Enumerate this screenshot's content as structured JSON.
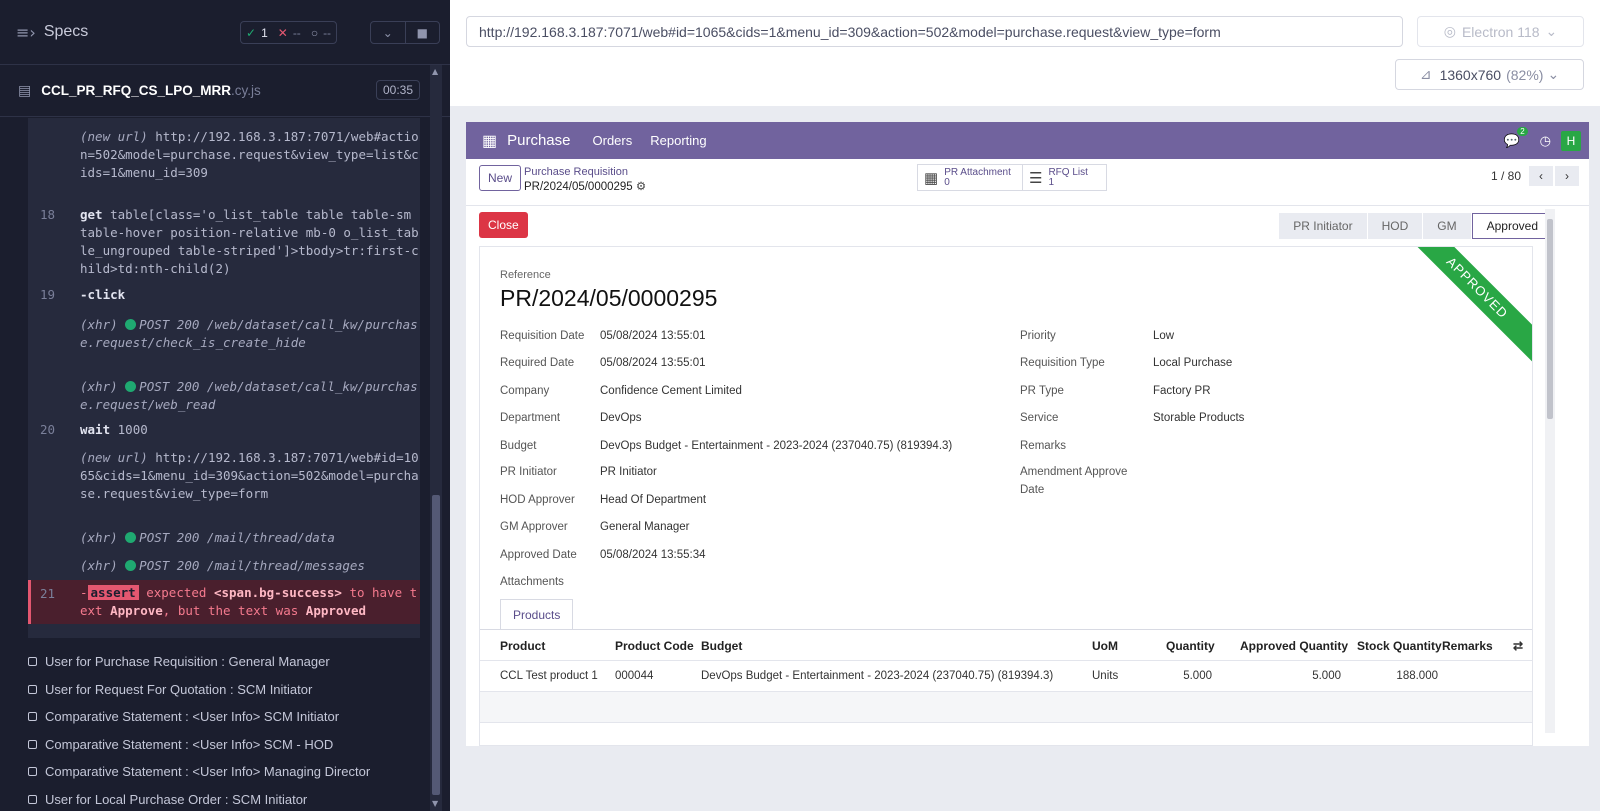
{
  "runner": {
    "specs_label": "Specs",
    "stats": {
      "passed": "1",
      "failed": "--",
      "pending": "--"
    },
    "file_name": "CCL_PR_RFQ_CS_LPO_MRR",
    "file_ext": ".cy.js",
    "timer": "00:35",
    "commands": [
      {
        "dim": "(new url)",
        "text": "http://192.168.3.187:7071/web#action=502&model=purchase.request&view_type=list&cids=1&menu_id=309"
      },
      {
        "num": "18",
        "kw": "get",
        "text": "table[class='o_list_table table table-sm table-hover position-relative mb-0 o_list_table_ungrouped table-striped']>tbody>tr:first-child>td:nth-child(2)"
      },
      {
        "num": "19",
        "kw": "-click"
      },
      {
        "dim": "(xhr)",
        "method": "POST 200",
        "text": "/web/dataset/call_kw/purchase.request/check_is_create_hide"
      },
      {
        "dim": "(xhr)",
        "method": "POST 200",
        "text": "/web/dataset/call_kw/purchase.request/web_read"
      },
      {
        "num": "20",
        "kw": "wait",
        "text": "1000"
      },
      {
        "dim": "(new url)",
        "text": "http://192.168.3.187:7071/web#id=1065&cids=1&menu_id=309&action=502&model=purchase.request&view_type=form"
      },
      {
        "dim": "(xhr)",
        "method": "POST 200",
        "text": "/mail/thread/data"
      },
      {
        "dim": "(xhr)",
        "method": "POST 200",
        "text": "/mail/thread/messages"
      }
    ],
    "error": {
      "num": "21",
      "dash": "-",
      "badge": "assert",
      "part1": "expected",
      "selector": "<span.bg-success>",
      "part2": "to have text",
      "expected": "Approve",
      "part3": ", but the text was",
      "actual": "Approved"
    },
    "tests": [
      "User for Purchase Requisition : General Manager",
      "User for Request For Quotation : SCM Initiator",
      "Comparative Statement : <User Info> SCM Initiator",
      "Comparative Statement : <User Info> SCM - HOD",
      "Comparative Statement : <User Info> Managing Director",
      "User for Local Purchase Order : SCM Initiator"
    ]
  },
  "browser": {
    "url": "http://192.168.3.187:7071/web#id=1065&cids=1&menu_id=309&action=502&model=purchase.request&view_type=form",
    "name": "Electron 118",
    "viewport": "1360x760",
    "zoom": "(82%)"
  },
  "app": {
    "navbar": {
      "app_name": "Purchase",
      "items": [
        "Orders",
        "Reporting"
      ],
      "chat_count": "2",
      "avatar": "H"
    },
    "control": {
      "new_label": "New",
      "breadcrumb_parent": "Purchase Requisition",
      "breadcrumb_current": "PR/2024/05/0000295",
      "smart_buttons": [
        {
          "label": "PR Attachment",
          "count": "0",
          "icon": "calendar-icon"
        },
        {
          "label": "RFQ List",
          "count": "1",
          "icon": "list-icon"
        }
      ],
      "pager": "1 / 80"
    },
    "close_label": "Close",
    "stages": [
      "PR Initiator",
      "HOD",
      "GM",
      "Approved"
    ],
    "ribbon": "APPROVED",
    "reference_label": "Reference",
    "reference": "PR/2024/05/0000295",
    "left_fields": [
      {
        "label": "Requisition Date",
        "value": "05/08/2024 13:55:01"
      },
      {
        "label": "Required Date",
        "value": "05/08/2024 13:55:01"
      },
      {
        "label": "Company",
        "value": "Confidence Cement Limited"
      },
      {
        "label": "Department",
        "value": "DevOps"
      },
      {
        "label": "Budget",
        "value": "DevOps Budget - Entertainment - 2023-2024 (237040.75) (819394.3)"
      },
      {
        "label": "PR Initiator",
        "value": "PR Initiator"
      },
      {
        "label": "HOD Approver",
        "value": "Head Of Department"
      },
      {
        "label": "GM Approver",
        "value": "General Manager"
      },
      {
        "label": "Approved Date",
        "value": "05/08/2024 13:55:34"
      },
      {
        "label": "Attachments",
        "value": ""
      }
    ],
    "right_fields": [
      {
        "label": "Priority",
        "value": "Low"
      },
      {
        "label": "Requisition Type",
        "value": "Local Purchase"
      },
      {
        "label": "PR Type",
        "value": "Factory PR"
      },
      {
        "label": "Service",
        "value": "Storable Products"
      },
      {
        "label": "Remarks",
        "value": ""
      },
      {
        "label": "Amendment Approve",
        "value": ""
      },
      {
        "label": "Date",
        "value": ""
      }
    ],
    "tab_label": "Products",
    "table": {
      "headers": [
        "Product",
        "Product Code",
        "Budget",
        "UoM",
        "Quantity",
        "Approved Quantity",
        "Stock Quantity",
        "Remarks"
      ],
      "row": [
        "CCL Test product 1",
        "000044",
        "DevOps Budget - Entertainment - 2023-2024 (237040.75) (819394.3)",
        "Units",
        "5.000",
        "5.000",
        "188.000",
        ""
      ]
    }
  }
}
